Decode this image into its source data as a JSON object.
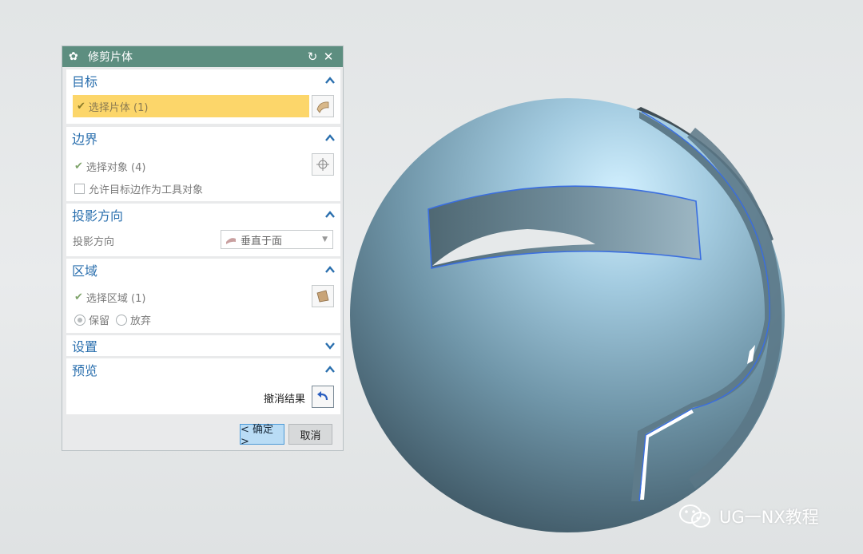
{
  "dialog": {
    "title": "修剪片体",
    "icons": {
      "settings": "gear-icon",
      "reset": "reset-icon",
      "close": "close-icon"
    }
  },
  "target_group": {
    "title": "目标",
    "select_body_label": "选择片体 (1)",
    "icon": "sheet-body-icon"
  },
  "boundary_group": {
    "title": "边界",
    "select_object_label": "选择对象 (4)",
    "allow_checkbox_label": "允许目标边作为工具对象",
    "icon": "crosshair-icon"
  },
  "projection_group": {
    "title": "投影方向",
    "field_label": "投影方向",
    "selected_value": "垂直于面"
  },
  "region_group": {
    "title": "区域",
    "select_region_label": "选择区域 (1)",
    "keep_label": "保留",
    "discard_label": "放弃",
    "selected": "保留"
  },
  "settings_group": {
    "title": "设置"
  },
  "preview_group": {
    "title": "预览",
    "undo_label": "撤消结果"
  },
  "footer": {
    "ok_label": "< 确定 >",
    "cancel_label": "取消"
  },
  "watermark": {
    "text": "UG一NX教程"
  },
  "colors": {
    "title_bar": "#5d8e80",
    "group_title": "#2a6fae",
    "selection_highlight": "#fcd66a",
    "ok_button": "#b9dcf5",
    "sphere": "#8fb6c8"
  }
}
